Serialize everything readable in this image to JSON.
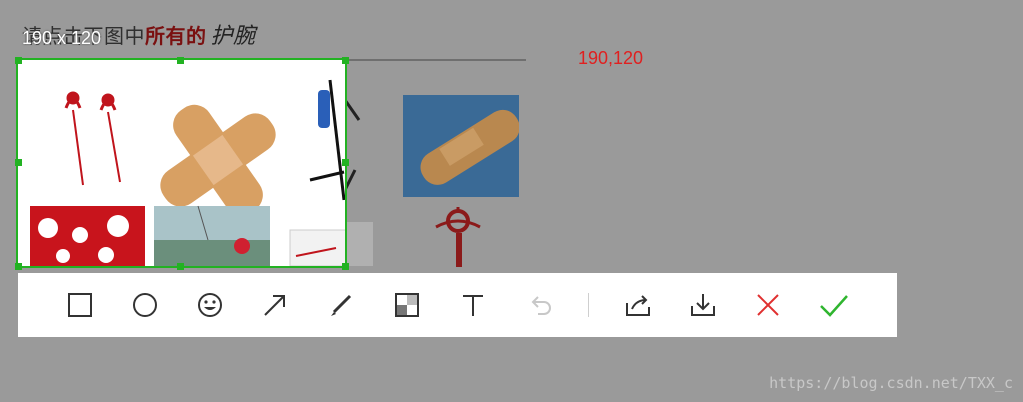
{
  "page": {
    "heading_prefix": "请点击下图中",
    "heading_highlight": "所有的",
    "heading_target": "护腕"
  },
  "capture": {
    "size_readout": "190 x 120",
    "coordinates": "190,120"
  },
  "toolbar": {
    "tools": [
      {
        "name": "rectangle-icon",
        "label": ""
      },
      {
        "name": "ellipse-icon",
        "label": ""
      },
      {
        "name": "emoji-icon",
        "label": ""
      },
      {
        "name": "arrow-icon",
        "label": ""
      },
      {
        "name": "pen-icon",
        "label": ""
      },
      {
        "name": "mosaic-icon",
        "label": ""
      },
      {
        "name": "text-icon",
        "label": ""
      },
      {
        "name": "undo-icon",
        "label": ""
      },
      {
        "name": "share-icon",
        "label": ""
      },
      {
        "name": "download-icon",
        "label": ""
      },
      {
        "name": "cancel-icon",
        "label": ""
      },
      {
        "name": "confirm-icon",
        "label": ""
      }
    ]
  },
  "colors": {
    "selection_border": "#22b222",
    "cancel": "#e03030",
    "confirm": "#2fb52f",
    "coordinates": "#e02020"
  },
  "watermark": "https://blog.csdn.net/TXX_c"
}
